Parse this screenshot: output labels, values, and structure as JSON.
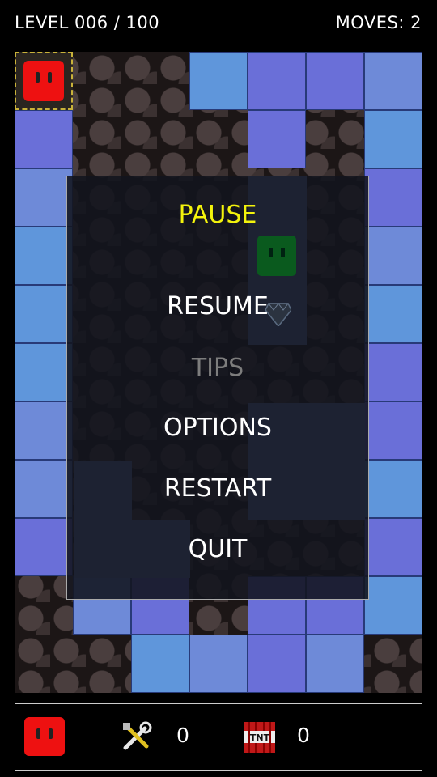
{
  "hud": {
    "level_text": "LEVEL 006 / 100",
    "moves_text": "MOVES: 2"
  },
  "pause_menu": {
    "title": "PAUSE",
    "items": [
      {
        "label": "RESUME",
        "enabled": true
      },
      {
        "label": "TIPS",
        "enabled": false
      },
      {
        "label": "OPTIONS",
        "enabled": true
      },
      {
        "label": "RESTART",
        "enabled": true
      },
      {
        "label": "QUIT",
        "enabled": true
      }
    ]
  },
  "inventory": {
    "tools_count": "0",
    "tnt_count": "0",
    "tnt_label": "TNT"
  },
  "colors": {
    "title": "#f3f30c",
    "disabled": "#7d7d7d",
    "player": "#ee1111"
  }
}
